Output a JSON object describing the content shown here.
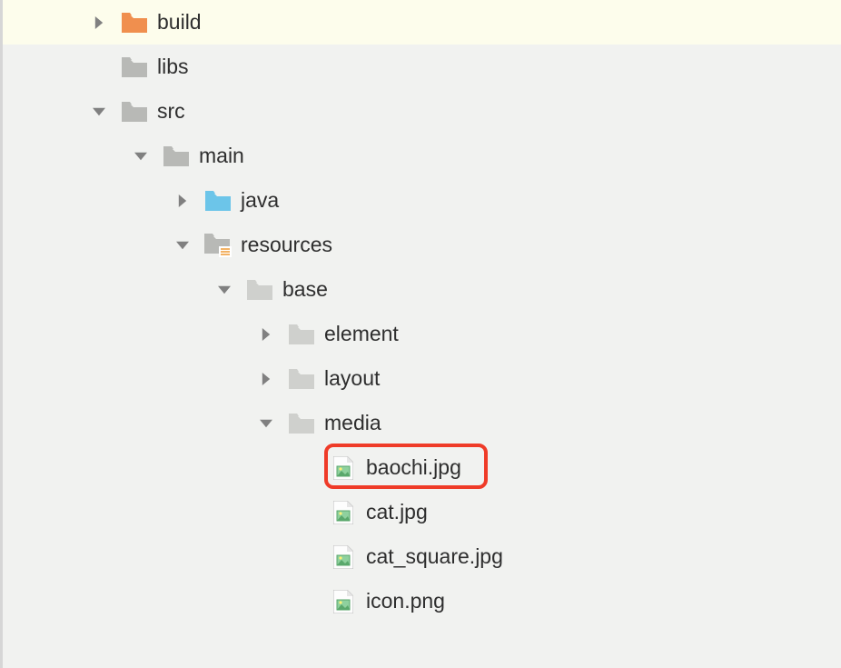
{
  "tree": {
    "build": "build",
    "libs": "libs",
    "src": "src",
    "main": "main",
    "java": "java",
    "resources": "resources",
    "base": "base",
    "element": "element",
    "layout": "layout",
    "media": "media",
    "baochi": "baochi.jpg",
    "cat": "cat.jpg",
    "cat_square": "cat_square.jpg",
    "icon_png": "icon.png"
  },
  "colors": {
    "folder_orange": "#f08f4e",
    "folder_gray": "#b8b9b6",
    "folder_blue": "#6cc5e9",
    "folder_light": "#cfd0cd",
    "arrow": "#808080",
    "highlight": "#ef3b28"
  }
}
